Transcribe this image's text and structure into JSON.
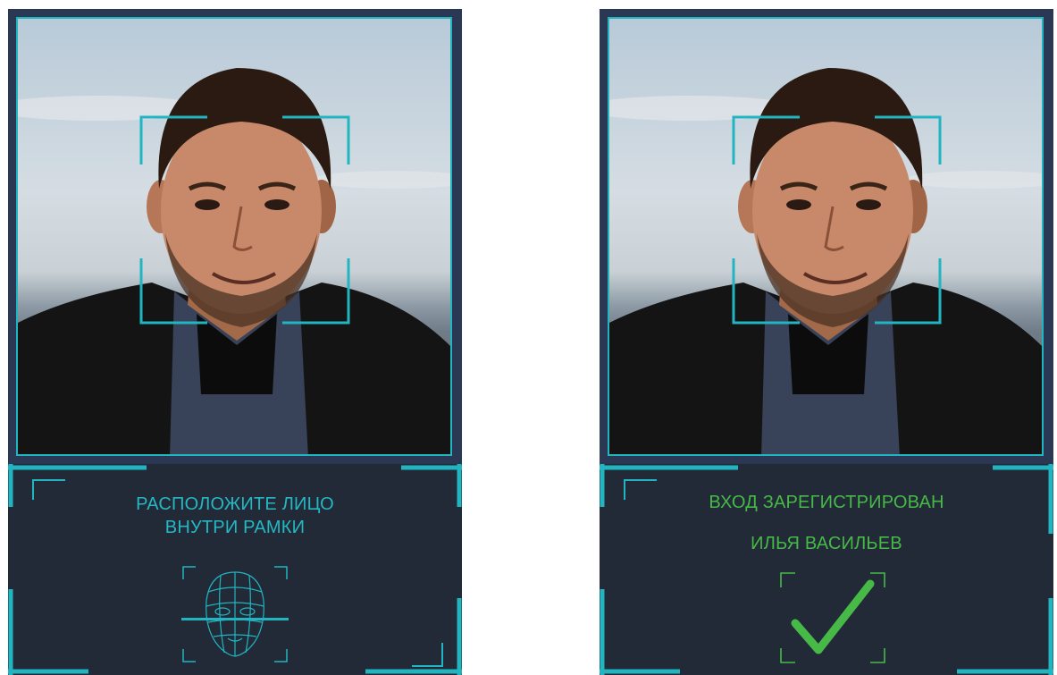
{
  "left_screen": {
    "state": "positioning",
    "message_line1": "РАСПОЛОЖИТЕ ЛИЦО",
    "message_line2": "ВНУТРИ РАМКИ",
    "status_icon": "face-scan-icon",
    "accent_color": "#21b5c1"
  },
  "right_screen": {
    "state": "recognized",
    "message_line1": "ВХОД ЗАРЕГИСТРИРОВАН",
    "person_name": "ИЛЬЯ ВАСИЛЬЕВ",
    "status_icon": "checkmark-icon",
    "accent_color": "#21b5c1",
    "success_color": "#46b947"
  },
  "colors": {
    "panel_background": "#2b3854",
    "status_background": "#222a37"
  }
}
